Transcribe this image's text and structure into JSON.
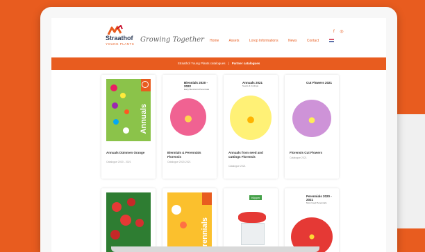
{
  "brand": {
    "name": "Straathof",
    "sub": "YOUNG PLANTS",
    "tagline": "Growing Together"
  },
  "social": {
    "facebook": "f",
    "instagram": "◎"
  },
  "nav": {
    "items": [
      "Home",
      "Assets",
      "Lorop Informations",
      "News",
      "Contact"
    ]
  },
  "breadcrumb": {
    "parent": "Straathof Young Plants catalogues",
    "current": "Partner catalogues"
  },
  "catalogues": [
    {
      "title": "Annuals Dümmen Orange",
      "sub": "Catalogue 2020 - 2021"
    },
    {
      "title": "Biennials & Perennials Florensis",
      "sub": "Catalogue 2020-2021",
      "badge_title": "Biennials 2020 - 2022",
      "badge_sub": "Early Biennial & Perennials"
    },
    {
      "title": "Annuals from seed and cuttings Florensis",
      "sub": "Catalogue 2021",
      "badge_title": "Annuals 2021",
      "badge_sub": "Seeds & Cuttings"
    },
    {
      "title": "Florensis Cut Flowers",
      "sub": "Catalogue 2021",
      "badge_title": "Cut Flowers 2021"
    },
    {
      "title": "",
      "sub": ""
    },
    {
      "title": "",
      "sub": "",
      "vertical": "Perennials"
    },
    {
      "title": "",
      "sub": "",
      "badge_title": "Klipper"
    },
    {
      "title": "",
      "sub": "",
      "badge_title": "Perennials 2020 - 2021",
      "badge_sub": "Most Used Perennials"
    }
  ],
  "cover_text": {
    "annuals": "Annuals",
    "perennials": "Perennials"
  }
}
